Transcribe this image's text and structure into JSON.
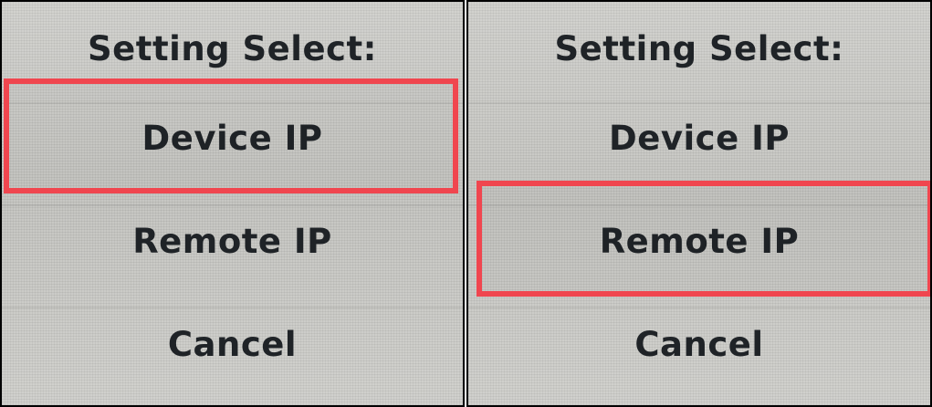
{
  "panels": [
    {
      "title": "Setting Select:",
      "options": [
        "Device IP",
        "Remote IP",
        "Cancel"
      ],
      "selected_option": "Device IP"
    },
    {
      "title": "Setting Select:",
      "options": [
        "Device IP",
        "Remote IP",
        "Cancel"
      ],
      "selected_option": "Remote IP"
    }
  ],
  "colors": {
    "highlight": "#f0464f",
    "text": "#1f2327",
    "screen_background": "#cdcdc9"
  }
}
